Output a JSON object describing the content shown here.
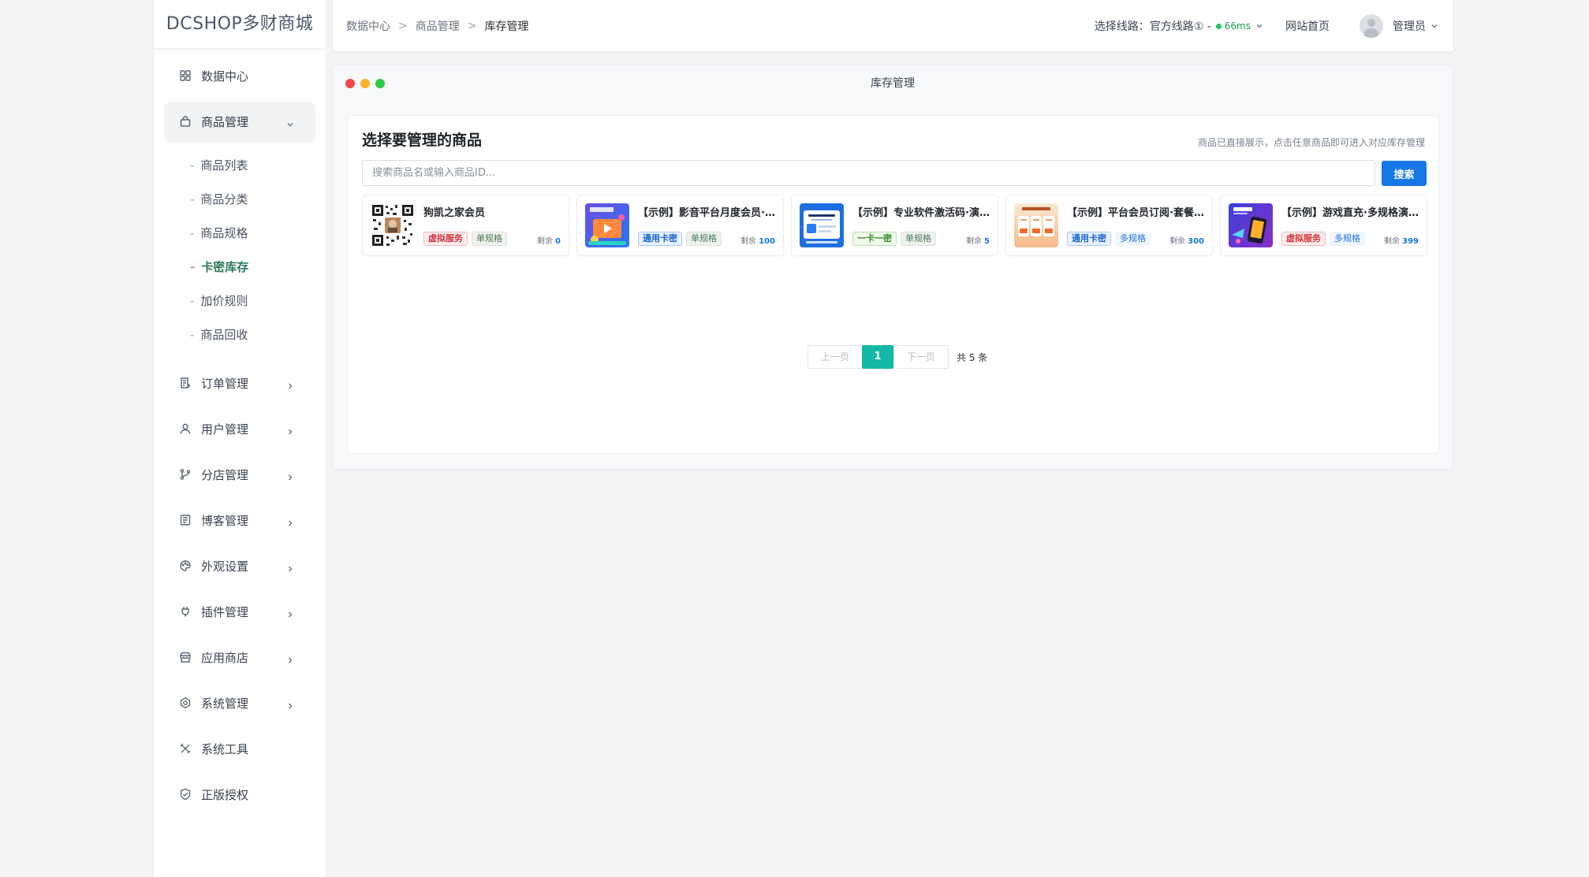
{
  "brand": "DCSHOP多财商城",
  "sidebar": {
    "items": [
      {
        "label": "数据中心",
        "icon": "dashboard-icon"
      },
      {
        "label": "商品管理",
        "icon": "bag-icon"
      },
      {
        "label": "订单管理",
        "icon": "order-icon"
      },
      {
        "label": "用户管理",
        "icon": "user-icon"
      },
      {
        "label": "分店管理",
        "icon": "branch-icon"
      },
      {
        "label": "博客管理",
        "icon": "blog-icon"
      },
      {
        "label": "外观设置",
        "icon": "palette-icon"
      },
      {
        "label": "插件管理",
        "icon": "plug-icon"
      },
      {
        "label": "应用商店",
        "icon": "store-icon"
      },
      {
        "label": "系统管理",
        "icon": "settings-icon"
      },
      {
        "label": "系统工具",
        "icon": "tools-icon"
      },
      {
        "label": "正版授权",
        "icon": "shield-icon"
      }
    ],
    "submenu": [
      "商品列表",
      "商品分类",
      "商品规格",
      "卡密库存",
      "加价规则",
      "商品回收"
    ],
    "active_sub": "卡密库存"
  },
  "header": {
    "breadcrumb": [
      "数据中心",
      "商品管理",
      "库存管理"
    ],
    "route_label": "选择线路：官方线路① -",
    "route_latency": "66ms",
    "home_link": "网站首页",
    "user_name": "管理员"
  },
  "panel": {
    "title": "库存管理",
    "card_title": "选择要管理的商品",
    "hint": "商品已直接展示，点击任意商品即可进入对应库存管理",
    "search_placeholder": "搜索商品名或输入商品ID...",
    "search_button": "搜索"
  },
  "products": [
    {
      "name": "狗凯之家会员",
      "tags": [
        {
          "text": "虚拟服务",
          "style": "red"
        },
        {
          "text": "单规格",
          "style": "gray"
        }
      ],
      "remain_label": "剩余",
      "remain": "0"
    },
    {
      "name": "【示例】影音平台月度会员·单规格演示",
      "tags": [
        {
          "text": "通用卡密",
          "style": "blue"
        },
        {
          "text": "单规格",
          "style": "gray"
        }
      ],
      "remain_label": "剩余",
      "remain": "100"
    },
    {
      "name": "【示例】专业软件激活码·演示商品",
      "tags": [
        {
          "text": "一卡一密",
          "style": "green"
        },
        {
          "text": "单规格",
          "style": "gray"
        }
      ],
      "remain_label": "剩余",
      "remain": "5"
    },
    {
      "name": "【示例】平台会员订阅·套餐演示",
      "tags": [
        {
          "text": "通用卡密",
          "style": "blue"
        },
        {
          "text": "多规格",
          "style": "lblue"
        }
      ],
      "remain_label": "剩余",
      "remain": "300"
    },
    {
      "name": "【示例】游戏直充·多规格演示商品",
      "tags": [
        {
          "text": "虚拟服务",
          "style": "red"
        },
        {
          "text": "多规格",
          "style": "lblue"
        }
      ],
      "remain_label": "剩余",
      "remain": "399"
    }
  ],
  "pagination": {
    "prev": "上一页",
    "current": "1",
    "next": "下一页",
    "total": "共 5 条"
  },
  "colors": {
    "accent": "#1677e6",
    "active_page": "#14b8a6",
    "active_sub": "#2c7a5a",
    "online": "#22c55e"
  }
}
